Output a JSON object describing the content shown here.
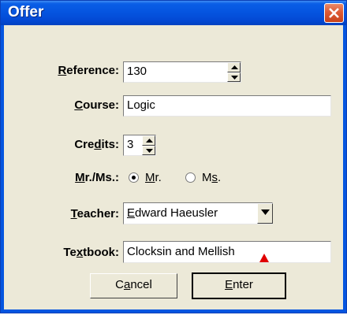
{
  "window": {
    "title": "Offer"
  },
  "fields": {
    "reference": {
      "label_pre": "",
      "label_key": "R",
      "label_post": "eference:",
      "value": "130"
    },
    "course": {
      "label_pre": "",
      "label_key": "C",
      "label_post": "ourse:",
      "value": "Logic"
    },
    "credits": {
      "label_pre": "Cre",
      "label_key": "d",
      "label_post": "its:",
      "value": "3"
    },
    "title_choice": {
      "label_pre": "",
      "label_key": "M",
      "label_post": "r./Ms.:",
      "selected": "Mr.",
      "options": [
        {
          "pre": "",
          "key": "M",
          "post": "r."
        },
        {
          "pre": "M",
          "key": "s",
          "post": "."
        }
      ]
    },
    "teacher": {
      "label_pre": "",
      "label_key": "T",
      "label_post": "eacher:",
      "value_key": "E",
      "value_rest": "dward Haeusler"
    },
    "textbook": {
      "label_pre": "Te",
      "label_key": "x",
      "label_post": "tbook:",
      "value": "Clocksin and Mellish"
    }
  },
  "buttons": {
    "cancel": {
      "pre": "C",
      "key": "a",
      "post": "ncel"
    },
    "enter": {
      "pre": "",
      "key": "E",
      "post": "nter"
    }
  },
  "icons": {
    "close": "close-icon",
    "spin_up": "arrow-up-icon",
    "spin_down": "arrow-down-icon",
    "dropdown": "chevron-down-icon",
    "cursor": "text-cursor-icon"
  },
  "colors": {
    "titlebar": "#0555e0",
    "close": "#dd5a34",
    "background": "#ece9d8",
    "cursor_mark": "#e00000"
  }
}
